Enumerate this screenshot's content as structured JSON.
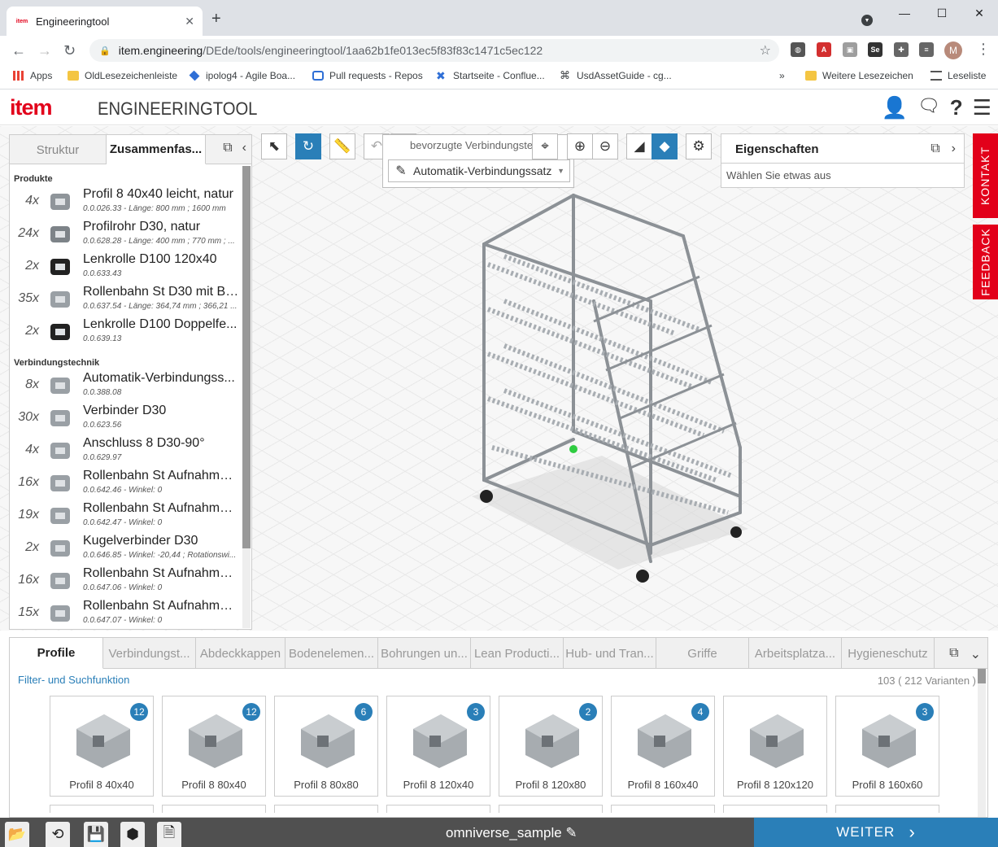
{
  "browser": {
    "tab_title": "Engineeringtool",
    "url_host": "item.engineering",
    "url_path": "/DEde/tools/engineeringtool/1aa62b1fe013ec5f83f83c1471c5ec122",
    "profile_initial": "M",
    "bookmarks": [
      "Apps",
      "OldLesezeichenleiste",
      "ipolog4 - Agile Boa...",
      "Pull requests - Repos",
      "Startseite - Conflue...",
      "UsdAssetGuide - cg...",
      "»",
      "Weitere Lesezeichen",
      "Leseliste"
    ]
  },
  "app": {
    "logo": "item",
    "title": "ENGINEERINGTOOL"
  },
  "left_panel": {
    "tabs": [
      "Struktur",
      "Zusammenfas..."
    ],
    "sections": [
      {
        "label": "Produkte",
        "items": [
          {
            "qty": "4x",
            "name": "Profil 8 40x40 leicht, natur",
            "sub": "0.0.026.33 - Länge: 800 mm ; 1600 mm"
          },
          {
            "qty": "24x",
            "name": "Profilrohr D30, natur",
            "sub": "0.0.628.28 - Länge: 400 mm ; 770 mm ; ..."
          },
          {
            "qty": "2x",
            "name": "Lenkrolle D100 120x40",
            "sub": "0.0.633.43"
          },
          {
            "qty": "35x",
            "name": "Rollenbahn St D30 mit Bo...",
            "sub": "0.0.637.54 - Länge: 364,74 mm ; 366,21 ..."
          },
          {
            "qty": "2x",
            "name": "Lenkrolle D100 Doppelfe...",
            "sub": "0.0.639.13"
          }
        ]
      },
      {
        "label": "Verbindungstechnik",
        "items": [
          {
            "qty": "8x",
            "name": "Automatik-Verbindungss...",
            "sub": "0.0.388.08"
          },
          {
            "qty": "30x",
            "name": "Verbinder D30",
            "sub": "0.0.623.56"
          },
          {
            "qty": "4x",
            "name": "Anschluss 8 D30-90°",
            "sub": "0.0.629.97"
          },
          {
            "qty": "16x",
            "name": "Rollenbahn St Aufnahme ...",
            "sub": "0.0.642.46 - Winkel: 0"
          },
          {
            "qty": "19x",
            "name": "Rollenbahn St Aufnahme ...",
            "sub": "0.0.642.47 - Winkel: 0"
          },
          {
            "qty": "2x",
            "name": "Kugelverbinder D30",
            "sub": "0.0.646.85 - Winkel: -20,44 ; Rotationswi..."
          },
          {
            "qty": "16x",
            "name": "Rollenbahn St Aufnahme ...",
            "sub": "0.0.647.06 - Winkel: 0"
          },
          {
            "qty": "15x",
            "name": "Rollenbahn St Aufnahme ...",
            "sub": "0.0.647.07 - Winkel: 0"
          }
        ]
      }
    ]
  },
  "toolbar": {
    "pref_label": "bevorzugte Verbindungstech",
    "pref_value": "Automatik-Verbindungssatz"
  },
  "properties": {
    "title": "Eigenschaften",
    "hint": "Wählen Sie etwas aus"
  },
  "side_tabs": {
    "contact": "KONTAKT",
    "feedback": "FEEDBACK"
  },
  "catalog": {
    "tabs": [
      "Profile",
      "Verbindungst...",
      "Abdeckkappen",
      "Bodenelemen...",
      "Bohrungen un...",
      "Lean Producti...",
      "Hub- und Tran...",
      "Griffe",
      "Arbeitsplatza...",
      "Hygieneschutz"
    ],
    "filter_label": "Filter- und Suchfunktion",
    "count": "103 ( 212 Varianten )",
    "cards": [
      {
        "name": "Profil 8 40x40",
        "badge": "12"
      },
      {
        "name": "Profil 8 80x40",
        "badge": "12"
      },
      {
        "name": "Profil 8 80x80",
        "badge": "6"
      },
      {
        "name": "Profil 8 120x40",
        "badge": "3"
      },
      {
        "name": "Profil 8 120x80",
        "badge": "2"
      },
      {
        "name": "Profil 8 160x40",
        "badge": "4"
      },
      {
        "name": "Profil 8 120x120",
        "badge": ""
      },
      {
        "name": "Profil 8 160x60",
        "badge": "3"
      }
    ]
  },
  "bottom": {
    "project_name": "omniverse_sample",
    "next_label": "WEITER"
  },
  "colors": {
    "brand_red": "#e2001a",
    "accent_blue": "#2a7fb8"
  }
}
